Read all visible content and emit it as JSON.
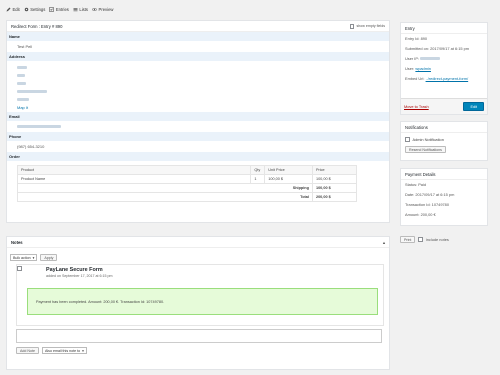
{
  "toolbar": {
    "items": [
      {
        "label": "Edit",
        "icon": "edit-icon"
      },
      {
        "label": "Settings",
        "icon": "gear-icon"
      },
      {
        "label": "Entries",
        "icon": "entries-icon"
      },
      {
        "label": "Lists",
        "icon": "list-icon"
      },
      {
        "label": "Preview",
        "icon": "eye-icon"
      }
    ]
  },
  "entry": {
    "title": "Redirect Form : Entry # 890",
    "show_empty_label": "show empty fields",
    "fields": {
      "name_label": "Name",
      "name_value": "Test Pell",
      "address_label": "Address",
      "map_link": "Map It",
      "email_label": "Email",
      "phone_label": "Phone",
      "phone_value": "(987) 654-3210",
      "order_label": "Order"
    },
    "order": {
      "headers": [
        "Product",
        "Qty",
        "Unit Price",
        "Price"
      ],
      "rows": [
        {
          "product": "Product Name",
          "qty": "1",
          "unit_price": "100,00 $",
          "price": "100,00 $"
        }
      ],
      "shipping_label": "Shipping",
      "shipping_value": "100,00 $",
      "total_label": "Total",
      "total_value": "200,00 $"
    }
  },
  "notes": {
    "title": "Notes",
    "bulk_action": "Bulk action",
    "apply": "Apply",
    "note_title": "PayLane Secure Form",
    "note_date": "added on September 17, 2017 at 6:15 pm",
    "note_message": "Payment has been completed. Amount: 200,00 €. Transaction Id: 10749780.",
    "add_note": "Add Note",
    "email_note": "Also email this note to"
  },
  "side": {
    "entry_title": "Entry",
    "entry_id": "Entry Id: 890",
    "submitted": "Submitted on: 2017/09/17 at 6:15 pm",
    "user_ip_label": "User IP:",
    "user_label": "User:",
    "user_value": "wpadmin",
    "embed_label": "Embed Url:",
    "embed_value": "../redirect-payment-form/",
    "trash": "Move to Trash",
    "edit": "Edit",
    "notifications_title": "Notifications",
    "admin_notification": "Admin Notification",
    "resend": "Resend Notifications",
    "payment_title": "Payment Details",
    "status": "Status: Paid",
    "date": "Date: 2017/09/17 at 6:15 pm",
    "transaction": "Transaction Id: 10749780",
    "amount": "Amount: 200,00 €",
    "print": "Print",
    "include_notes": "include notes"
  },
  "colors": {
    "primary": "#0085ba",
    "label_bg": "#eaf2fa",
    "success_bg": "#e6fbd9",
    "trash": "#aa0000"
  }
}
